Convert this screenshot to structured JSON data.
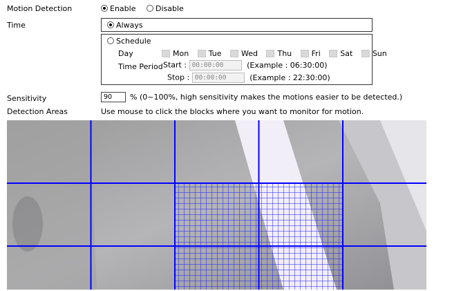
{
  "motion_detection": {
    "label": "Motion Detection",
    "options": [
      {
        "label": "Enable",
        "selected": true
      },
      {
        "label": "Disable",
        "selected": false
      }
    ]
  },
  "time": {
    "label": "Time",
    "always_label": "Always",
    "always_selected": true,
    "schedule_label": "Schedule",
    "schedule_selected": false,
    "day_label": "Day",
    "days": [
      "Mon",
      "Tue",
      "Wed",
      "Thu",
      "Fri",
      "Sat",
      "Sun"
    ],
    "time_period_label": "Time Period",
    "start_label": "Start :",
    "start_value": "00:00:00",
    "start_example": "(Example : 06:30:00)",
    "stop_label": "Stop :",
    "stop_value": "00:00:00",
    "stop_example": "(Example : 22:30:00)"
  },
  "sensitivity": {
    "label": "Sensitivity",
    "value": "90",
    "note": "% (0~100%, high sensitivity makes the motions easier to be detected.)"
  },
  "detection_areas": {
    "label": "Detection Areas",
    "instruction": "Use mouse to click the blocks where you want to monitor for motion.",
    "grid_color": "#0000ff",
    "grid_rows": 3,
    "grid_cols": 5,
    "selected_blocks": [
      [
        1,
        2
      ],
      [
        1,
        3
      ],
      [
        2,
        2
      ],
      [
        2,
        3
      ]
    ]
  }
}
